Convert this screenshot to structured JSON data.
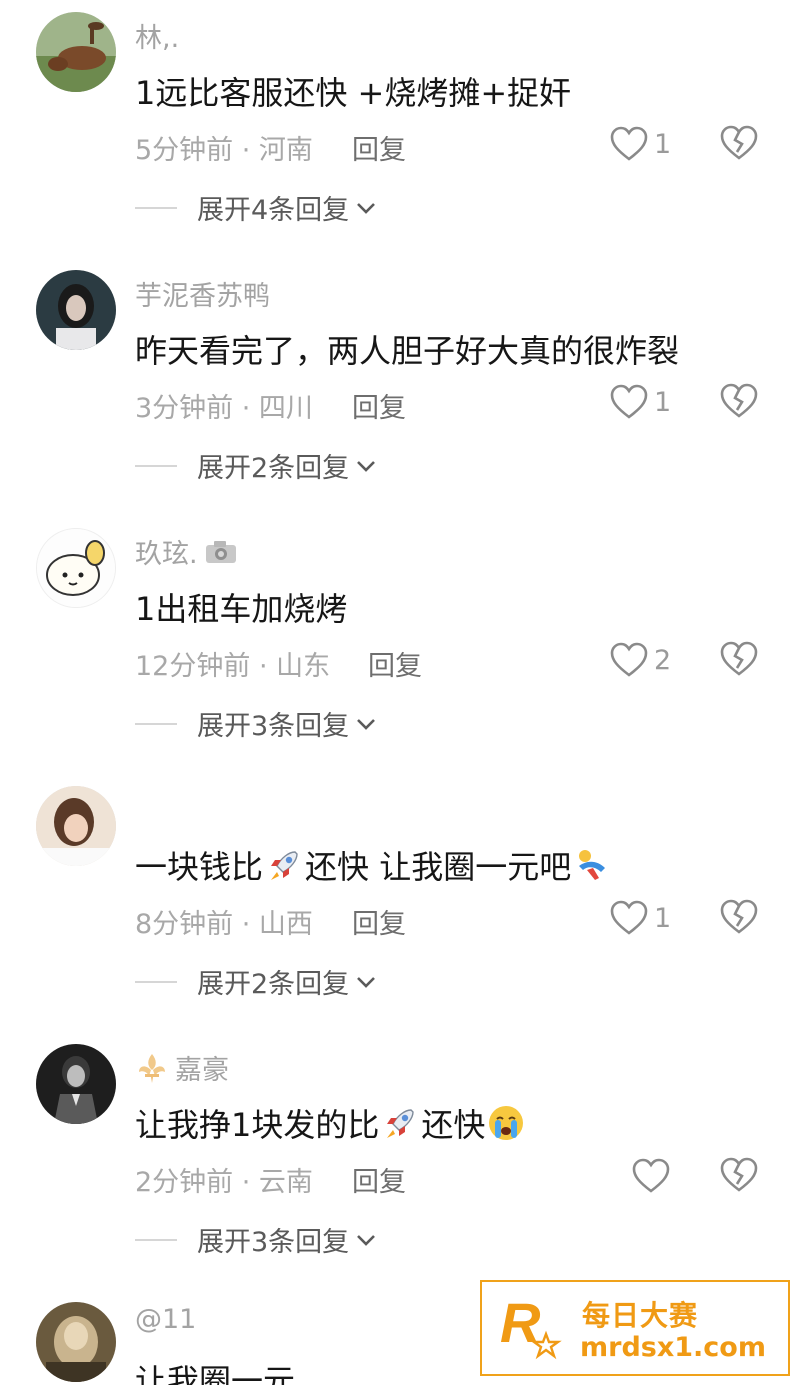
{
  "comments": [
    {
      "username": "林,.",
      "text": "1远比客服还快 +烧烤摊+捉奸",
      "meta": "5分钟前 · 河南",
      "reply_label": "回复",
      "likes": "1",
      "expand_label": "展开4条回复"
    },
    {
      "username": "芋泥香苏鸭",
      "text": "昨天看完了，两人胆子好大真的很炸裂",
      "meta": "3分钟前 · 四川",
      "reply_label": "回复",
      "likes": "1",
      "expand_label": "展开2条回复"
    },
    {
      "username": "玖玹.",
      "username_icon": "camera-icon",
      "text": "1出租车加烧烤",
      "meta": "12分钟前 · 山东",
      "reply_label": "回复",
      "likes": "2",
      "expand_label": "展开3条回复"
    },
    {
      "username": "",
      "text_parts": [
        "一块钱比",
        "还快 让我圈一元吧"
      ],
      "emojis": [
        "rocket-emoji",
        "dancing-emoji"
      ],
      "meta": "8分钟前 · 山西",
      "reply_label": "回复",
      "likes": "1",
      "expand_label": "展开2条回复"
    },
    {
      "username": "嘉豪",
      "username_icon": "fleur-de-lis-icon",
      "text_parts": [
        "让我挣1块发的比",
        "还快"
      ],
      "emojis": [
        "rocket-emoji",
        "crying-emoji"
      ],
      "meta": "2分钟前 · 云南",
      "reply_label": "回复",
      "likes": "",
      "expand_label": "展开3条回复"
    },
    {
      "username": "@11",
      "text": "让我圈一元"
    }
  ],
  "watermark": {
    "title": "每日大赛",
    "url": "mrdsx1.com",
    "logo_letter": "R"
  },
  "colors": {
    "username": "#a3a3a3",
    "text": "#161616",
    "meta": "#a8a8a8",
    "watermark_accent": "#f09a14"
  }
}
